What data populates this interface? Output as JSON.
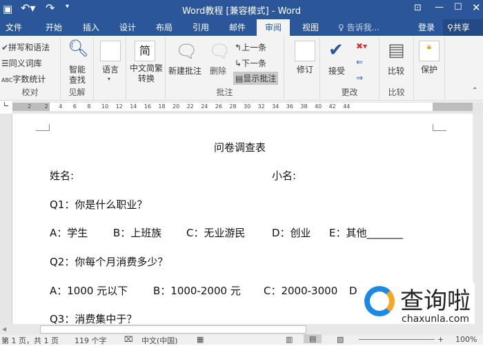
{
  "titlebar": {
    "title": "Word教程 [兼容模式] - Word"
  },
  "tabs": [
    "文件",
    "开始",
    "插入",
    "设计",
    "布局",
    "引用",
    "邮件",
    "审阅",
    "视图"
  ],
  "tell_me": "告诉我...",
  "signin": "登录",
  "share": "共享",
  "ribbon": {
    "proofing": {
      "label": "校对",
      "items": [
        "拼写和语法",
        "同义词库",
        "字数统计"
      ]
    },
    "insights": {
      "label": "见解",
      "smart_lookup": "智能查找"
    },
    "language": {
      "label": "语言"
    },
    "chinese": {
      "label": "中文简繁转换"
    },
    "comments": {
      "label": "批注",
      "new": "新建批注",
      "delete": "删除",
      "prev": "上一条",
      "next": "下一条",
      "show": "显示批注"
    },
    "tracking": {
      "label": "修订"
    },
    "changes": {
      "label": "更改",
      "accept": "接受"
    },
    "compare": {
      "label": "比较",
      "button": "比较"
    },
    "protect": {
      "label": "保护"
    }
  },
  "ruler": {
    "ticks": [
      "2",
      "2",
      "4",
      "6",
      "8",
      "10",
      "12",
      "14",
      "16",
      "18",
      "20",
      "22",
      "24",
      "26",
      "28",
      "30",
      "32",
      "34",
      "36",
      "38",
      "40",
      "42",
      "44"
    ]
  },
  "document": {
    "title": "问卷调查表",
    "name": "姓名:",
    "nickname": "小名:",
    "q1": "Q1：你是什么职业？",
    "q1_options": [
      "A：学生",
      "B：上班族",
      "C：无业游民",
      "D：创业",
      "E：其他_______"
    ],
    "q2": "Q2：你每个月消费多少？",
    "q2_options": [
      "A：1000 元以下",
      "B：1000-2000 元",
      "C：2000-3000",
      "D："
    ],
    "q3": "Q3：消费集中于？"
  },
  "watermark": {
    "brand": "查询啦",
    "url": "chaxunla.com"
  },
  "status": {
    "page": "第 1 页，共 1 页",
    "words": "119 个字",
    "language": "中文(中国)",
    "zoom": "100%"
  },
  "colors": {
    "accent": "#2b579a",
    "watermark_blue": "#1e88e5",
    "watermark_orange": "#f5a623"
  }
}
